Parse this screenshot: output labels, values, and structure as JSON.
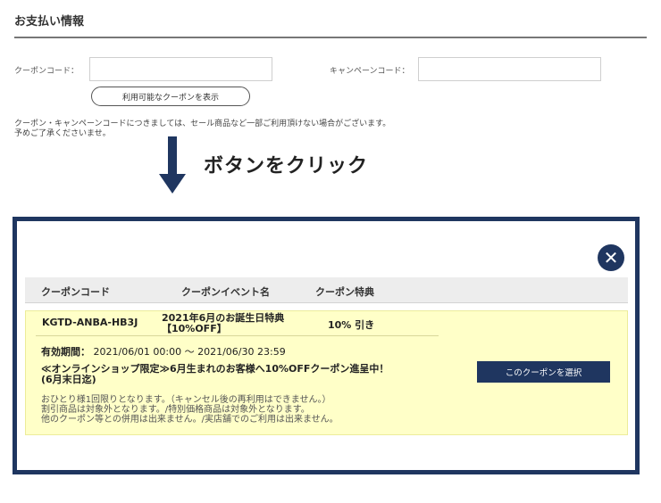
{
  "page": {
    "section_title": "お支払い情報",
    "coupon_label": "クーポンコード：",
    "coupon_value": "",
    "campaign_label": "キャンペーンコード：",
    "campaign_value": "",
    "show_coupons_label": "利用可能なクーポンを表示",
    "note_line1": "クーポン・キャンペーンコードにつきましては、セール商品など一部ご利用頂けない場合がございます。",
    "note_line2": "予めご了承くださいませ。",
    "callout": "ボタンをクリック"
  },
  "modal": {
    "close_symbol": "✕",
    "headers": {
      "code": "クーポンコード",
      "event": "クーポンイベント名",
      "benefit": "クーポン特典"
    },
    "coupon": {
      "code": "KGTD-ANBA-HB3J",
      "event_line1": "2021年6月のお誕生日特典",
      "event_line2": "【10%OFF】",
      "benefit": "10% 引き",
      "period_label": "有効期間：",
      "period_value": "2021/06/01 00:00 〜 2021/06/30 23:59",
      "promo_line1": "≪オンラインショップ限定≫6月生まれのお客様へ10%OFFクーポン進呈中！",
      "promo_line2": "(6月末日迄)",
      "terms_line1": "おひとり様1回限りとなります。（キャンセル後の再利用はできません。）",
      "terms_line2": "割引商品は対象外となります。/特別価格商品は対象外となります。",
      "terms_line3": "他のクーポン等との併用は出来ません。/実店舗でのご利用は出来ません。",
      "select_label": "このクーポンを選択"
    }
  },
  "colors": {
    "navy": "#1f3660",
    "coupon_bg": "#ffffc8",
    "header_bg": "#ededed"
  }
}
